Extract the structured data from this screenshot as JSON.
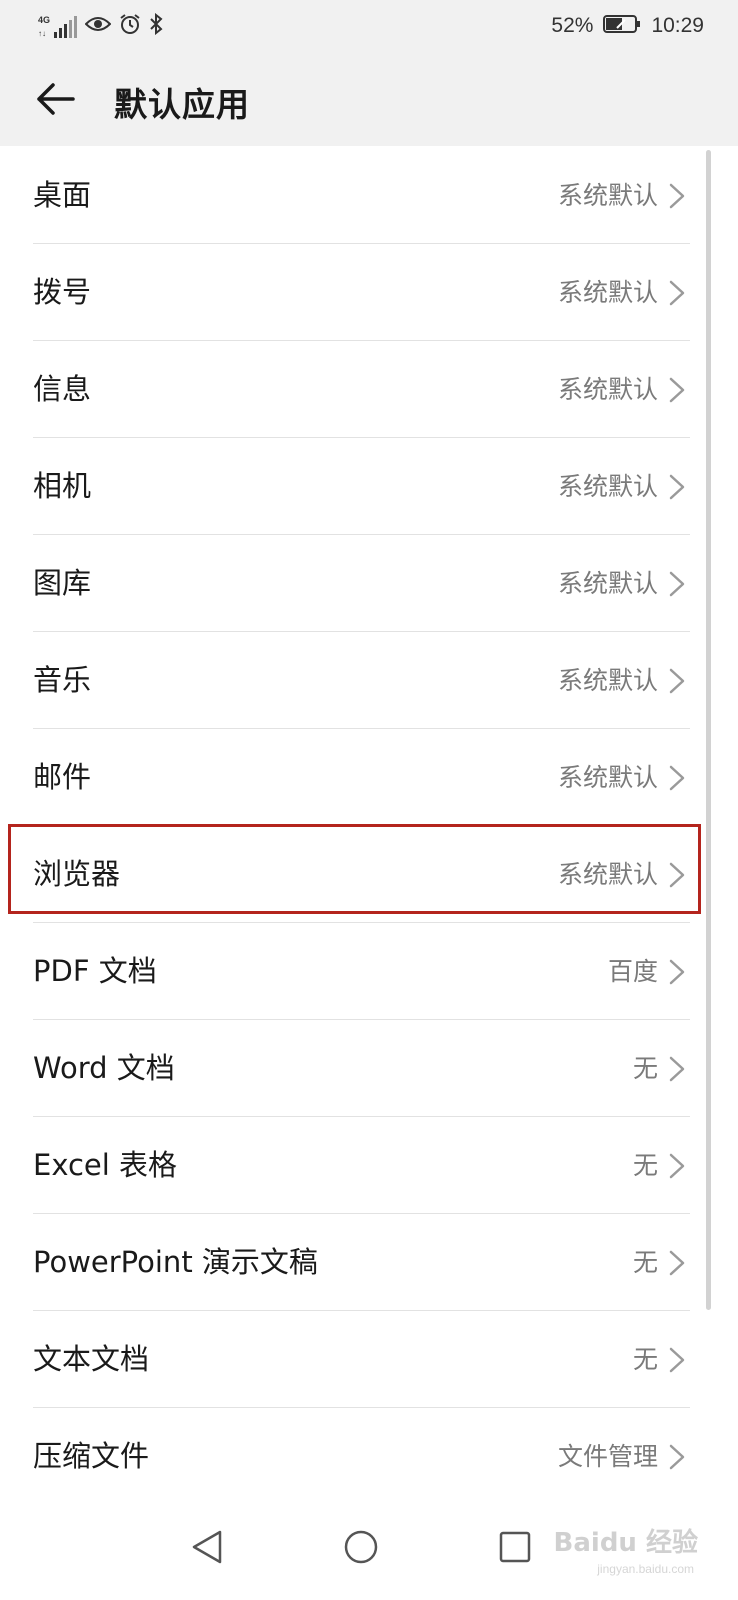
{
  "status_bar": {
    "network": "4G",
    "battery_percent": "52%",
    "time": "10:29"
  },
  "header": {
    "title": "默认应用"
  },
  "items": [
    {
      "label": "桌面",
      "value": "系统默认"
    },
    {
      "label": "拨号",
      "value": "系统默认"
    },
    {
      "label": "信息",
      "value": "系统默认"
    },
    {
      "label": "相机",
      "value": "系统默认"
    },
    {
      "label": "图库",
      "value": "系统默认"
    },
    {
      "label": "音乐",
      "value": "系统默认"
    },
    {
      "label": "邮件",
      "value": "系统默认"
    },
    {
      "label": "浏览器",
      "value": "系统默认"
    },
    {
      "label": "PDF 文档",
      "value": "百度"
    },
    {
      "label": "Word 文档",
      "value": "无"
    },
    {
      "label": "Excel 表格",
      "value": "无"
    },
    {
      "label": "PowerPoint 演示文稿",
      "value": "无"
    },
    {
      "label": "文本文档",
      "value": "无"
    },
    {
      "label": "压缩文件",
      "value": "文件管理"
    }
  ],
  "highlight_color": "#b4241d",
  "watermark": {
    "main": "Baidu 经验",
    "sub": "jingyan.baidu.com"
  }
}
